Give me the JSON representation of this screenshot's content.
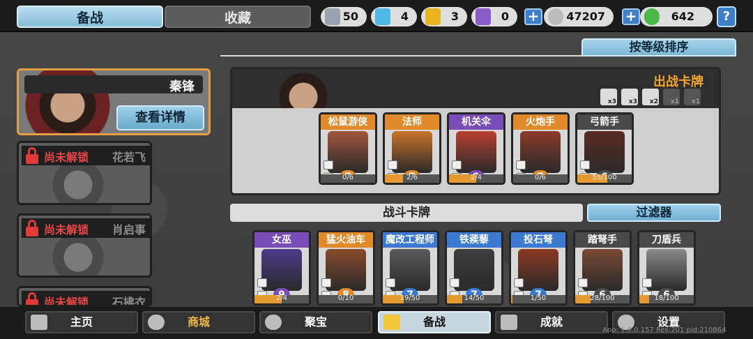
{
  "tabs": {
    "active": "备战",
    "inactive": "收藏"
  },
  "resources": [
    {
      "icon": "silver-shield-icon",
      "value": "50",
      "color": "#9aa4b0"
    },
    {
      "icon": "blue-crystal-icon",
      "value": "4",
      "color": "#4fb6e8"
    },
    {
      "icon": "gold-shield-icon",
      "value": "3",
      "color": "#e8b520"
    },
    {
      "icon": "purple-shield-icon",
      "value": "0",
      "color": "#8a5cc8"
    }
  ],
  "coins": {
    "value": "47207"
  },
  "gems": {
    "value": "642"
  },
  "help_label": "?",
  "sort_label": "按等级排序",
  "selected_hero": {
    "name": "秦锋",
    "detail_label": "查看详情"
  },
  "locked_heroes": [
    {
      "lock_text": "尚未解锁",
      "name": "花若飞"
    },
    {
      "lock_text": "尚未解锁",
      "name": "肖启事"
    },
    {
      "lock_text": "尚未解锁",
      "name": "石拂衣"
    }
  ],
  "deck": {
    "title": "出战卡牌",
    "quotas": [
      {
        "label": "x3",
        "on": true
      },
      {
        "label": "x3",
        "on": true
      },
      {
        "label": "x2",
        "on": true
      },
      {
        "label": "x1",
        "on": false
      },
      {
        "label": "x1",
        "on": false
      }
    ],
    "cards": [
      {
        "name": "松鼠游侠",
        "level": "7",
        "progress": "0/6",
        "fill": 0.0,
        "rarity": "#e08a2c",
        "art": "#a0563a"
      },
      {
        "name": "法师",
        "level": "7",
        "progress": "2/6",
        "fill": 0.33,
        "rarity": "#e08a2c",
        "art": "#c8742a"
      },
      {
        "name": "机关伞",
        "level": "9",
        "progress": "2/4",
        "fill": 0.5,
        "rarity": "#7a4cb6",
        "art": "#b8402e"
      },
      {
        "name": "火炮手",
        "level": "7",
        "progress": "0/6",
        "fill": 0.0,
        "rarity": "#e08a2c",
        "art": "#8c3a2a"
      },
      {
        "name": "弓箭手",
        "level": "6",
        "progress": "55/100",
        "fill": 0.55,
        "rarity": "#4a4a4a",
        "art": "#5a2a24"
      }
    ]
  },
  "battle_section_label": "战斗卡牌",
  "filter_label": "过滤器",
  "battle_cards": [
    {
      "name": "女巫",
      "level": "9",
      "progress": "2/4",
      "fill": 0.5,
      "rarity": "#7a4cb6",
      "art": "#4b3a8c"
    },
    {
      "name": "猛火油车",
      "level": "8",
      "progress": "0/10",
      "fill": 0.0,
      "rarity": "#e08a2c",
      "art": "#8a4a2a"
    },
    {
      "name": "魔改工程师",
      "level": "7",
      "progress": "19/50",
      "fill": 0.38,
      "rarity": "#3a7ad0",
      "art": "#5a5a5a"
    },
    {
      "name": "铁蒺藜",
      "level": "7",
      "progress": "14/50",
      "fill": 0.28,
      "rarity": "#3a7ad0",
      "art": "#3e3e3e"
    },
    {
      "name": "投石弩",
      "level": "7",
      "progress": "1/50",
      "fill": 0.02,
      "rarity": "#3a7ad0",
      "art": "#8c3a22"
    },
    {
      "name": "踏弩手",
      "level": "6",
      "progress": "28/100",
      "fill": 0.28,
      "rarity": "#4a4a4a",
      "art": "#7a4a34"
    },
    {
      "name": "刀盾兵",
      "level": "6",
      "progress": "18/100",
      "fill": 0.18,
      "rarity": "#4a4a4a",
      "art": "#8a8a8a"
    }
  ],
  "nav": [
    {
      "label": "主页",
      "icon": "home-icon"
    },
    {
      "label": "商城",
      "icon": "shop-icon"
    },
    {
      "label": "聚宝",
      "icon": "treasure-icon"
    },
    {
      "label": "备战",
      "icon": "cards-icon"
    },
    {
      "label": "成就",
      "icon": "achievements-icon"
    },
    {
      "label": "设置",
      "icon": "gear-icon"
    }
  ],
  "version": "App: 1.0.0.157 Res:201 pid:210864"
}
